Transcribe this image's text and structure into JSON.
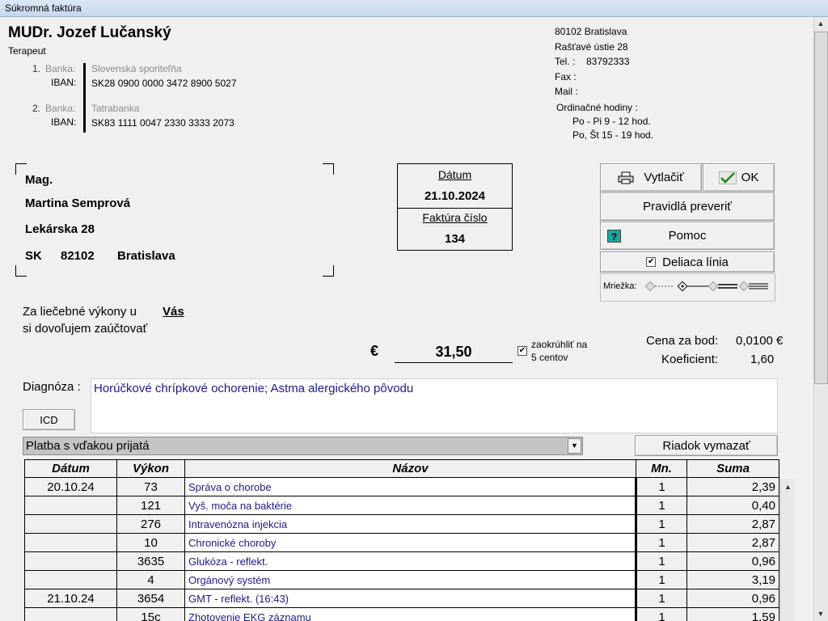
{
  "window": {
    "title": "Súkromná faktúra"
  },
  "doctor": {
    "name": "MUDr. Jozef Lučanský",
    "title": "Terapeut"
  },
  "banks": [
    {
      "num": "1.",
      "bank_label": "Banka:",
      "bank_name": "Slovenská sporiteľňa",
      "iban_label": "IBAN:",
      "iban": "SK28 0900 0000 3472 8900 5027"
    },
    {
      "num": "2.",
      "bank_label": "Banka:",
      "bank_name": "Tatrabanka",
      "iban_label": "IBAN:",
      "iban": "SK83 1111 0047 2330 3333 2073"
    }
  ],
  "address": {
    "city": "80102  Bratislava",
    "street": "Rašťavé ústie 28",
    "tel_label": "Tel. :",
    "tel": "83792333",
    "fax_label": "Fax :",
    "mail_label": "Mail :",
    "hours_label": "Ordinačné hodiny :",
    "hours_1": "Po - Pi  9 - 12 hod.",
    "hours_2": "Po, Št  15 - 19 hod."
  },
  "recipient": {
    "title": "Mag.",
    "name": "Martina Semprová",
    "street": "Lekárska 28",
    "country": "SK",
    "zip": "82102",
    "city": "Bratislava"
  },
  "invoice": {
    "date_label": "Dátum",
    "date": "21.10.2024",
    "number_label": "Faktúra číslo",
    "number": "134"
  },
  "buttons": {
    "print": "Vytlačiť",
    "ok": "OK",
    "rules": "Pravidlá preveriť",
    "help": "Pomoc",
    "separator": "Deliaca línia",
    "grid_label": "Mriežka:",
    "icd": "ICD",
    "delete_row": "Riadok vymazať"
  },
  "intro": {
    "line1": "Za liečebné výkony u",
    "line2": "si dovoľujem zaúčtovať",
    "who": "Vás"
  },
  "total": {
    "currency": "€",
    "amount": "31,50",
    "round_line1": "zaokrúhliť na",
    "round_line2": "5 centov"
  },
  "price": {
    "point_label": "Cena za bod:",
    "point_value": "0,0100 €",
    "coef_label": "Koeficient:",
    "coef_value": "1,60"
  },
  "diagnosis": {
    "label": "Diagnóza :",
    "text": "Horúčkové chrípkové ochorenie; Astma alergického pôvodu"
  },
  "payment": {
    "selected": "Platba s vďakou prijatá"
  },
  "table": {
    "headers": {
      "date": "Dátum",
      "code": "Výkon",
      "name": "Názov",
      "qty": "Mn.",
      "sum": "Suma"
    },
    "rows": [
      {
        "date": "20.10.24",
        "code": "73",
        "name": "Správa o chorobe",
        "qty": "1",
        "sum": "2,39"
      },
      {
        "date": "",
        "code": "121",
        "name": "Vyš. moča na baktérie",
        "qty": "1",
        "sum": "0,40"
      },
      {
        "date": "",
        "code": "276",
        "name": "Intravenózna injekcia",
        "qty": "1",
        "sum": "2,87"
      },
      {
        "date": "",
        "code": "10",
        "name": "Chronické choroby",
        "qty": "1",
        "sum": "2,87"
      },
      {
        "date": "",
        "code": "3635",
        "name": "Glukóza - reflekt.",
        "qty": "1",
        "sum": "0,96"
      },
      {
        "date": "",
        "code": "4",
        "name": "Orgánový systém",
        "qty": "1",
        "sum": "3,19"
      },
      {
        "date": "21.10.24",
        "code": "3654",
        "name": "GMT - reflekt. (16:43)",
        "qty": "1",
        "sum": "0,96"
      },
      {
        "date": "",
        "code": "15c",
        "name": "Zhotovenie EKG záznamu",
        "qty": "1",
        "sum": "1,59"
      }
    ]
  }
}
